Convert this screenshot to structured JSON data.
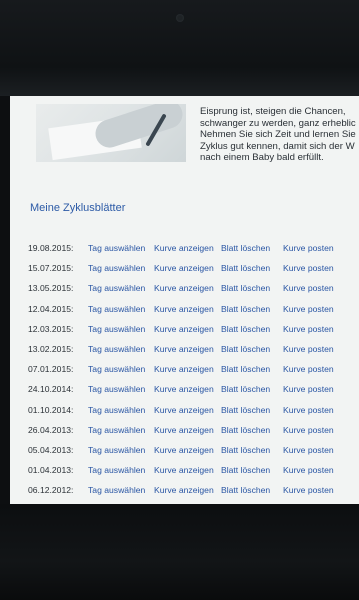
{
  "intro": {
    "lines": [
      "Eisprung ist, steigen die Chancen,",
      "schwanger zu werden, ganz erheblic",
      "Nehmen Sie sich Zeit und lernen Sie",
      "Zyklus gut kennen, damit sich der W",
      "nach einem Baby bald erfüllt."
    ]
  },
  "section_title": "Meine Zyklusblätter",
  "actions": {
    "select": "Tag auswählen",
    "curve": "Kurve anzeigen",
    "delete": "Blatt löschen",
    "post": "Kurve posten"
  },
  "rows": [
    {
      "date": "19.08.2015:"
    },
    {
      "date": "15.07.2015:"
    },
    {
      "date": "13.05.2015:"
    },
    {
      "date": "12.04.2015:"
    },
    {
      "date": "12.03.2015:"
    },
    {
      "date": "13.02.2015:"
    },
    {
      "date": "07.01.2015:"
    },
    {
      "date": "24.10.2014:"
    },
    {
      "date": "01.10.2014:"
    },
    {
      "date": "26.04.2013:"
    },
    {
      "date": "05.04.2013:"
    },
    {
      "date": "01.04.2013:"
    },
    {
      "date": "06.12.2012:"
    }
  ]
}
